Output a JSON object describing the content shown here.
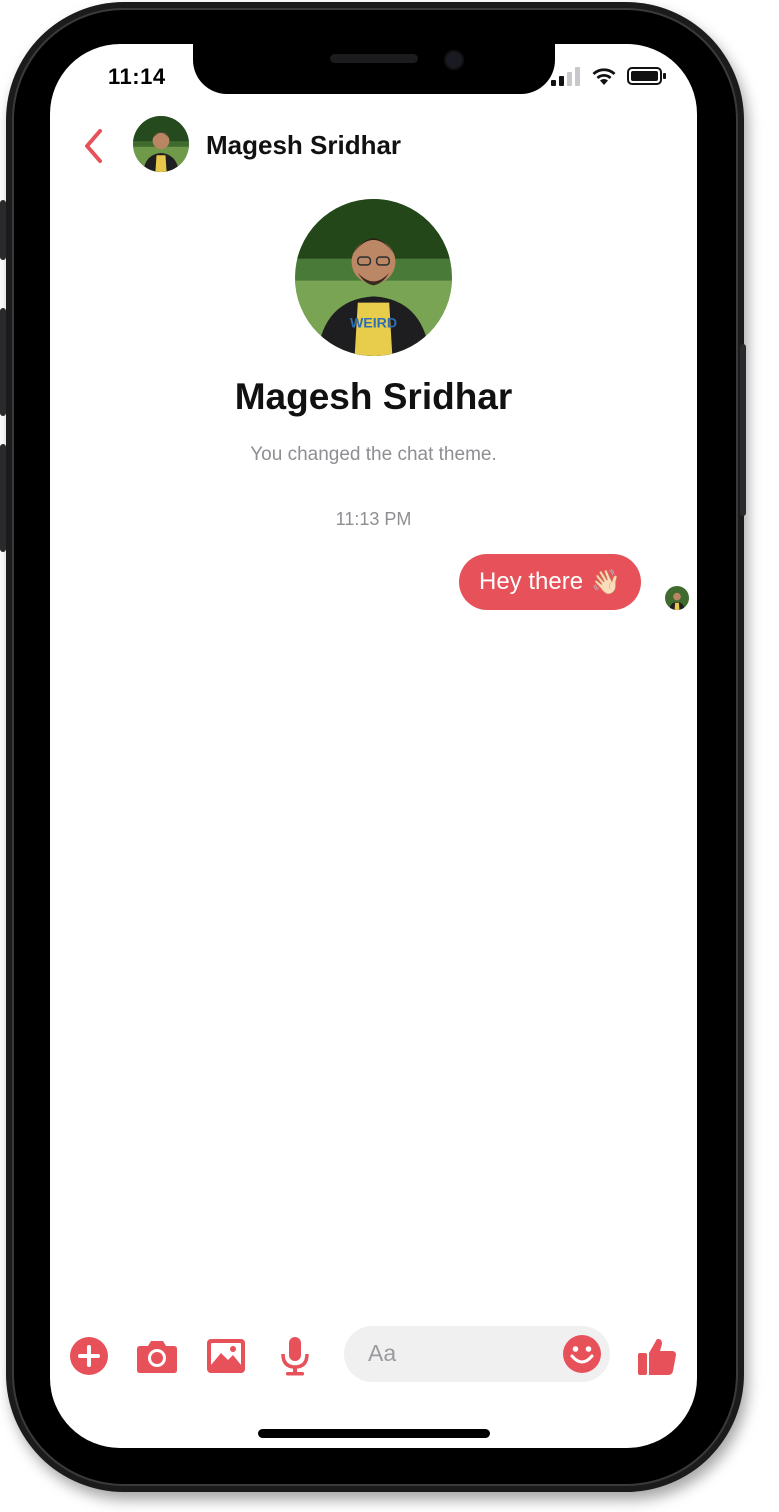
{
  "status_bar": {
    "time": "11:14"
  },
  "header": {
    "back_label": "",
    "contact_name": "Magesh Sridhar"
  },
  "profile": {
    "name": "Magesh Sridhar",
    "theme_note": "You changed the chat theme."
  },
  "conversation": {
    "timestamp": "11:13 PM",
    "messages": [
      {
        "text": "Hey there",
        "emoji": "👋🏻",
        "sender": "me"
      }
    ]
  },
  "composer": {
    "placeholder": "Aa",
    "icons": [
      "add-icon",
      "camera-icon",
      "gallery-icon",
      "microphone-icon",
      "emoji-icon",
      "thumbs-up-icon"
    ]
  },
  "colors": {
    "accent": "#e7525a",
    "bubble_text": "#ffffff",
    "muted": "#8e8e93"
  }
}
